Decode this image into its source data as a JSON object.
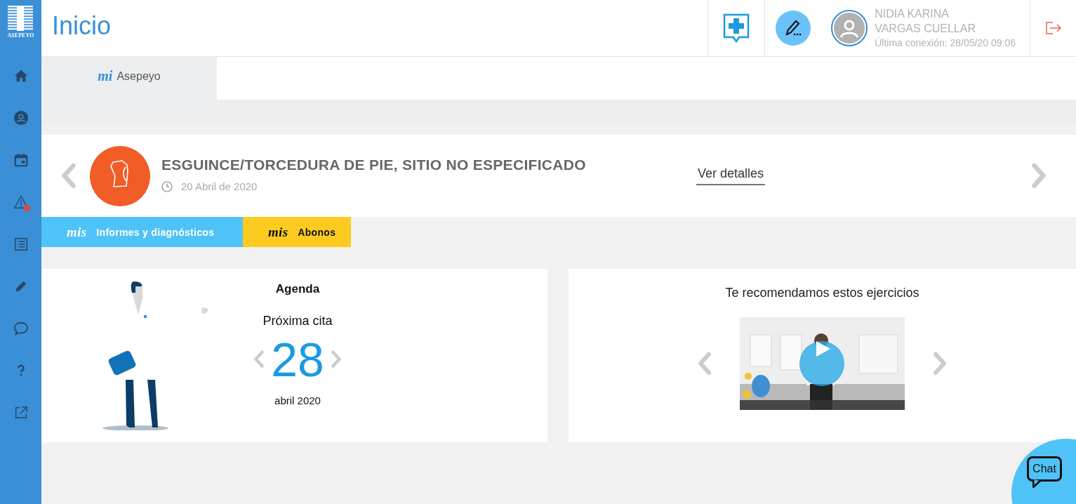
{
  "sidebar": {
    "logo_text": "ASEPEYO",
    "items": [
      {
        "kind": "home",
        "notification": false
      },
      {
        "kind": "profile",
        "notification": false
      },
      {
        "kind": "calendar",
        "notification": false
      },
      {
        "kind": "alert",
        "notification": true
      },
      {
        "kind": "list",
        "notification": false
      },
      {
        "kind": "edit",
        "notification": false
      },
      {
        "kind": "chat",
        "notification": false
      },
      {
        "kind": "help",
        "notification": false
      },
      {
        "kind": "external",
        "notification": false
      }
    ]
  },
  "header": {
    "title": "Inicio",
    "user": {
      "name_line_1": "NIDIA KARINA",
      "name_line_2": "VARGAS CUELLAR",
      "last_login": "Última conexión: 28/05/20 09:06"
    }
  },
  "tabs": [
    {
      "prefix": "mi",
      "label": "Asepeyo",
      "selected": true
    }
  ],
  "case": {
    "title": "ESGUINCE/TORCEDURA DE PIE, SITIO NO ESPECIFICADO",
    "date": "20 Abril de 2020",
    "link": "Ver detalles"
  },
  "sections": [
    {
      "prefix": "mis",
      "label": "Informes y diagnósticos",
      "color": "#4fc3f7"
    },
    {
      "prefix": "mis",
      "label": "Abonos",
      "color": "#fdcb1f"
    }
  ],
  "agenda": {
    "title": "Agenda",
    "subtitle": "Próxima cita",
    "day": "28",
    "month": "abril 2020"
  },
  "exercises": {
    "title": "Te recomendamos estos ejercicios"
  },
  "chat": {
    "label": "Chat"
  }
}
